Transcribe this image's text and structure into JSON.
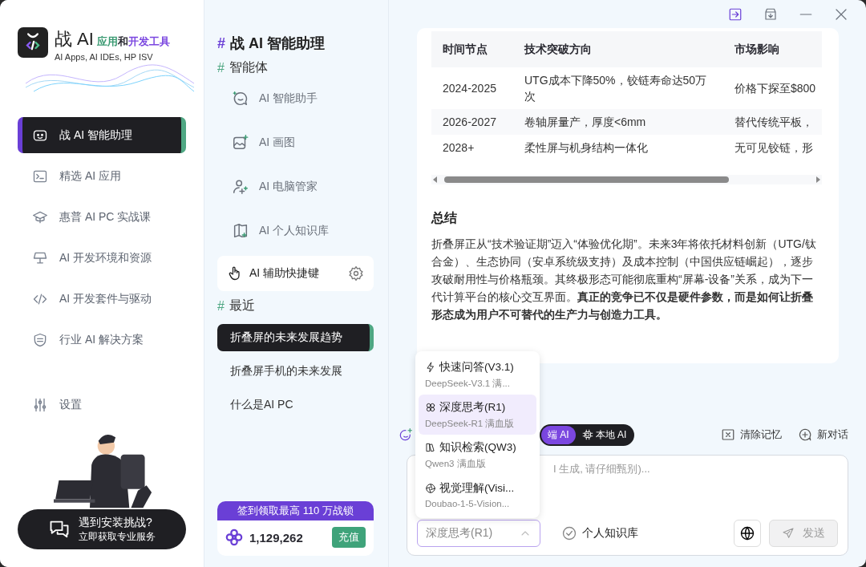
{
  "title_bar": {
    "buttons": [
      {
        "kind": "panel",
        "selected": true
      },
      {
        "kind": "download",
        "selected": false
      },
      {
        "kind": "minimize",
        "selected": false
      },
      {
        "kind": "close",
        "selected": false
      }
    ]
  },
  "sidebar": {
    "logo": {
      "title": "战 AI",
      "subtitle": [
        {
          "text": "应用",
          "color": "#3a9a72"
        },
        {
          "text": "和",
          "color": "#2b2b33"
        },
        {
          "text": "开发工具",
          "color": "#7b47e0"
        }
      ],
      "tagline": "AI Apps, AI IDEs, HP ISV"
    },
    "items": [
      {
        "label": "战 AI 智能助理",
        "kind": "bot",
        "selected": true
      },
      {
        "label": "精选 AI 应用",
        "kind": "terminal",
        "selected": false
      },
      {
        "label": "惠普 AI PC 实战课",
        "kind": "cap",
        "selected": false
      },
      {
        "label": "AI 开发环境和资源",
        "kind": "lamp",
        "selected": false
      },
      {
        "label": "AI 开发套件与驱动",
        "kind": "code",
        "selected": false
      },
      {
        "label": "行业 AI 解决方案",
        "kind": "shield",
        "selected": false
      }
    ],
    "settings": "设置",
    "help": {
      "title": "遇到安装挑战?",
      "subtitle": "立即获取专业服务"
    }
  },
  "assistant_panel": {
    "title": {
      "marker": "#",
      "text": "战 AI 智能助理"
    },
    "agents_heading": {
      "marker": "#",
      "text": "智能体"
    },
    "agents": [
      {
        "label": "AI 智能助手",
        "kind": "chat"
      },
      {
        "label": "AI 画图",
        "kind": "image"
      },
      {
        "label": "AI 电脑管家",
        "kind": "person"
      },
      {
        "label": "AI 个人知识库",
        "kind": "book"
      }
    ],
    "shortcut": "AI 辅助快捷键",
    "recent_heading": {
      "marker": "#",
      "text": "最近"
    },
    "recent": [
      {
        "label": "折叠屏的未来发展趋势",
        "selected": true
      },
      {
        "label": "折叠屏手机的未来发展",
        "selected": false
      },
      {
        "label": "什么是AI PC",
        "selected": false
      }
    ],
    "promo": {
      "banner": "签到领取最高 110 万战锁",
      "points": "1,129,262",
      "recharge": "充值"
    }
  },
  "answer": {
    "table": {
      "columns": [
        "时间节点",
        "技术突破方向",
        "市场影响"
      ],
      "rows": [
        [
          "2024-2025",
          "UTG成本下降50%，铰链寿命达50万次",
          "价格下探至$800"
        ],
        [
          "2026-2027",
          "卷轴屏量产，厚度<6mm",
          "替代传统平板，"
        ],
        [
          "2028+",
          "柔性屏与机身结构一体化",
          "无可见铰链，形"
        ]
      ]
    },
    "heading": "总结",
    "paragraph": "折叠屏正从“技术验证期”迈入“体验优化期”。未来3年将依托材料创新（UTG/钛合金）、生态协同（安卓系统级支持）及成本控制（中国供应链崛起），逐步攻破耐用性与价格瓶颈。其终极形态可能彻底重构“屏幕-设备”关系，成为下一代计算平台的核心交互界面。**真正的竞争已不仅是硬件参数，而是如何让折叠形态成为用户不可替代的生产力与创造力工具。**"
  },
  "chat_toolbar": {
    "modes": [
      {
        "label": "端 AI",
        "kind": "plain",
        "selected": true
      },
      {
        "label": "本地 AI",
        "kind": "chip",
        "selected": false
      }
    ],
    "actions": [
      {
        "label": "清除记忆",
        "kind": "erase"
      },
      {
        "label": "新对话",
        "kind": "plus"
      }
    ]
  },
  "input": {
    "placeholder": "I 生成, 请仔细甄别)...",
    "model_select": {
      "value": "深度思考(R1)",
      "expanded": true
    },
    "knowledge": {
      "label": "个人知识库",
      "checked": false
    },
    "send": {
      "label": "发送",
      "disabled": true
    }
  },
  "model_menu": [
    {
      "title": "快速问答(V3.1)",
      "subtitle": "DeepSeek-V3.1 满...",
      "kind": "bolt",
      "selected": false
    },
    {
      "title": "深度思考(R1)",
      "subtitle": "DeepSeek-R1 满血版",
      "kind": "atom",
      "selected": true
    },
    {
      "title": "知识检索(QW3)",
      "subtitle": "Qwen3 满血版",
      "kind": "books",
      "selected": false
    },
    {
      "title": "视觉理解(Visi...",
      "subtitle": "Doubao-1-5-Vision...",
      "kind": "aperture",
      "selected": false
    }
  ]
}
